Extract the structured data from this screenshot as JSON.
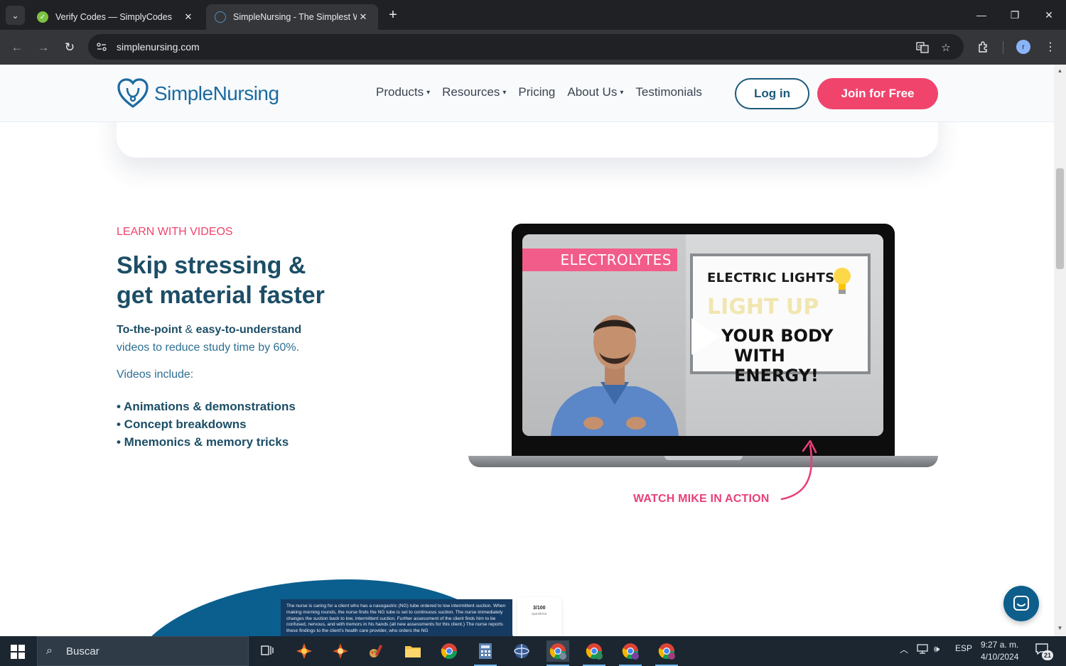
{
  "browser": {
    "tabs": [
      {
        "title": "Verify Codes — SimplyCodes",
        "active": false
      },
      {
        "title": "SimpleNursing - The Simplest W",
        "active": true
      }
    ],
    "url": "simplenursing.com",
    "new_tab_symbol": "+",
    "close_symbol": "✕",
    "profile_initial": "r"
  },
  "site": {
    "logo_text": "SimpleNursing",
    "nav": [
      {
        "label": "Products",
        "dropdown": true
      },
      {
        "label": "Resources",
        "dropdown": true
      },
      {
        "label": "Pricing",
        "dropdown": false
      },
      {
        "label": "About Us",
        "dropdown": true
      },
      {
        "label": "Testimonials",
        "dropdown": false
      }
    ],
    "login_label": "Log in",
    "join_label": "Join for Free",
    "brand_colors": {
      "primary": "#1c4e66",
      "accent": "#f0446c",
      "logo": "#1b6aa0"
    }
  },
  "section": {
    "eyebrow": "LEARN WITH VIDEOS",
    "headline_line1": "Skip stressing &",
    "headline_line2": "get material faster",
    "lead_bold1": "To-the-point",
    "lead_amp": " & ",
    "lead_bold2": "easy-to-understand",
    "lead_rest": "videos to reduce study time by 60%.",
    "videos_include": "Videos include:",
    "bullets": [
      "• Animations & demonstrations",
      "• Concept breakdowns",
      "• Mnemonics & memory tricks"
    ]
  },
  "video": {
    "tag": "ELECTROLYTES",
    "board_line1": "ELECTRIC LIGHTS",
    "board_line2": "LIGHT UP",
    "board_line3a": "YOUR BODY",
    "board_line3b": "WITH ENERGY!",
    "caption": "WATCH MIKE IN ACTION"
  },
  "teaser": {
    "question_text": "The nurse is caring for a client who has a nasogastric (NG) tube ordered to low intermittent suction. When making morning rounds, the nurse finds the NG tube is set to continuous suction. The nurse immediately changes the suction back to low, intermittent suction. Further assessment of the client finds him to be confused, nervous, and with tremors in his hands (all new assessments for this client.) The nurse reports these findings to the client's health care provider, who orders the NG",
    "counter_main": "3/100",
    "counter_sub": "questions"
  },
  "taskbar": {
    "search_placeholder": "Buscar",
    "language": "ESP",
    "time": "9:27 a. m.",
    "date": "4/10/2024",
    "notification_count": "21"
  }
}
